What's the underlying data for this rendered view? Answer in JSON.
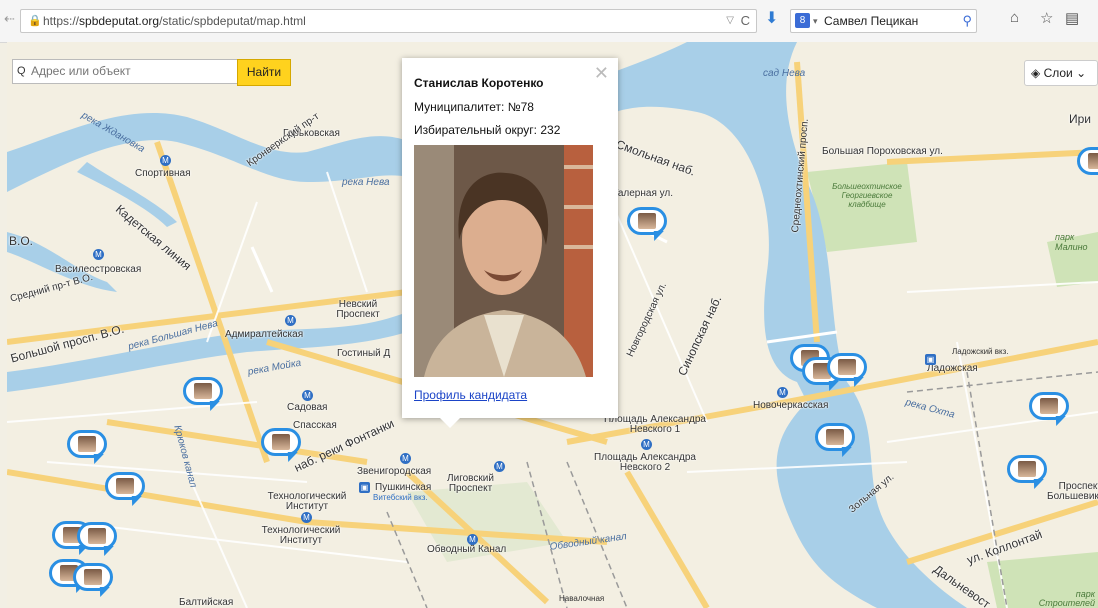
{
  "browser": {
    "url_prefix": "https://",
    "url_domain": "spbdeputat.org",
    "url_path": "/static/spbdeputat/map.html",
    "search_user": "Самвел Пецикан"
  },
  "map": {
    "search_placeholder": "Адрес или объект",
    "find_label": "Найти",
    "layers_label": "Слои"
  },
  "popup": {
    "name": "Станислав Коротенко",
    "municipality": "Муниципалитет: №78",
    "district": "Избирательный округ: 232",
    "profile_link": "Профиль кандидата"
  },
  "labels": {
    "gorkovskaya": "Горьковская",
    "kronverk": "Кронверкский пр-т",
    "sportivnaya": "Спортивная",
    "zhdanovka": "река Ждановка",
    "reka_neva": "река Нева",
    "kadetskaya": "Кадетская линия",
    "vasileo": "Василеостровская",
    "vo": "В.О.",
    "sredniy": "Средний пр-т В.О.",
    "bolshoy_vo": "Большой просп. В.О.",
    "bolshaya_neva": "река Большая Нева",
    "moika": "река Мойка",
    "admiralteyskaya": "Адмиралтейская",
    "nevskiy": "Невский Проспект",
    "gostiny": "Гостиный Д",
    "sadovaya": "Садовая",
    "spasskaya": "Спасская",
    "fontanka": "наб. реки Фонтанки",
    "kryukov": "Крюков канал",
    "zvenigorodskaya": "Звенигородская",
    "pushkinskaya": "Пушкинская",
    "vitebskiy": "Витебский вкз.",
    "ligovskiy": "Лиговский Проспект",
    "tehinst1": "Технологический Институт",
    "tehinst2": "Технологический Институт",
    "obvodny": "Обводный Канал",
    "obvodny_canal": "Обводный канал",
    "baltiyskaya": "Балтийская",
    "navalochnaya": "Навалочная",
    "smolnaya": "Смольная наб.",
    "galernaya": "Галерная ул.",
    "novgorodskaya": "Новгородская ул.",
    "sinopskaya": "Синопская наб.",
    "pl_al_1": "Площадь Александра Невского 1",
    "pl_al_2": "Площадь Александра Невского 2",
    "sad_neva": "сад Нева",
    "irina": "Ири",
    "sredneokhtinsky": "Среднеохтинский просп.",
    "bolshaya_porokh": "Большая Пороховская ул.",
    "cemetery": "Большеохтинское Георгиевское кладбище",
    "park_malin": "парк Малино",
    "ladozhskiy_vkz": "Ладожский вкз.",
    "ladozhskaya": "Ладожская",
    "novocherkasskaya": "Новочеркасская",
    "okhta": "река Охта",
    "zolnaya": "Зольная ул.",
    "kollontai": "ул. Коллонтай",
    "prospekt_bolsh": "Проспект Большевико",
    "dalnevost": "Дальневост",
    "park_stroit": "парк Строителей",
    "pochta": "Фонтанка",
    "reka_neva2": "река Нева",
    "obvodny2": "Обводный канал"
  }
}
